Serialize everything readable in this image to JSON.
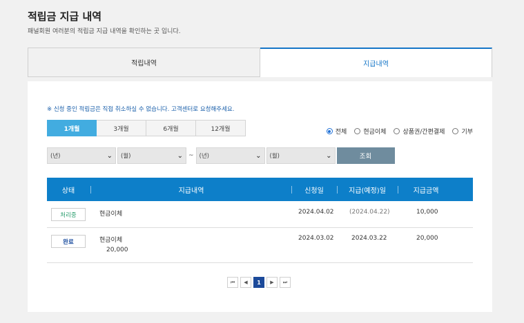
{
  "header": {
    "title": "적립금 지급 내역",
    "subtitle": "패널회원 여러분의 적립금 지급 내역을 확인하는 곳 입니다."
  },
  "tabs": [
    {
      "label": "적립내역",
      "active": false
    },
    {
      "label": "지급내역",
      "active": true
    }
  ],
  "notice": "※ 신청 중인 적립금은 직접 취소하실 수 없습니다. 고객센터로 요청해주세요.",
  "period_buttons": [
    {
      "label": "1개월",
      "active": true
    },
    {
      "label": "3개월",
      "active": false
    },
    {
      "label": "6개월",
      "active": false
    },
    {
      "label": "12개월",
      "active": false
    }
  ],
  "radio_options": [
    {
      "label": "전체",
      "checked": true
    },
    {
      "label": "현금이체",
      "checked": false
    },
    {
      "label": "상품권/간편결제",
      "checked": false
    },
    {
      "label": "기부",
      "checked": false
    }
  ],
  "filters": {
    "start_year": "(년)",
    "start_month": "(월)",
    "separator": "~",
    "end_year": "(년)",
    "end_month": "(월)",
    "search_label": "조회"
  },
  "table": {
    "headers": [
      "상태",
      "지급내역",
      "신청일",
      "지급(예정)일",
      "지급금액"
    ],
    "rows": [
      {
        "status": "처리중",
        "desc": "현금이체",
        "desc2": "",
        "applied": "2024.04.02",
        "pay_date": "(2024.04.22)",
        "amount": "10,000"
      },
      {
        "status": "완료",
        "desc": "현금이체",
        "desc2": "20,000",
        "applied": "2024.03.02",
        "pay_date": "2024.03.22",
        "amount": "20,000"
      }
    ]
  },
  "pagination": {
    "first": "⏮",
    "prev": "◀",
    "current": "1",
    "next": "▶",
    "last": "⏭"
  },
  "colors": {
    "accent": "#1475c7",
    "table_header": "#0d7fc9",
    "period_active": "#42ace0",
    "search_button": "#6f8c9e",
    "page_active": "#1c4a9a"
  }
}
